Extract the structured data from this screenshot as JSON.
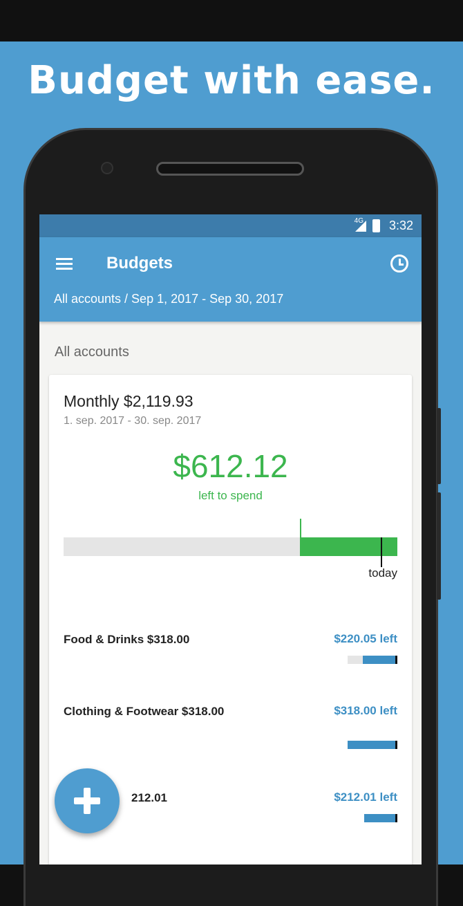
{
  "promo": {
    "headline": "Budget with ease."
  },
  "status_bar": {
    "network": "4G",
    "time": "3:32"
  },
  "app_bar": {
    "title": "Budgets",
    "subtitle": "All accounts / Sep 1, 2017 - Sep 30, 2017",
    "menu_icon": "hamburger-menu-icon",
    "history_icon": "clock-history-icon"
  },
  "section": {
    "label": "All accounts"
  },
  "budget": {
    "title": "Monthly $2,119.93",
    "dates": "1. sep. 2017 - 30. sep. 2017",
    "left_amount": "$612.12",
    "left_label": "left to spend",
    "spent_fraction": 0.711,
    "today_fraction": 0.953,
    "today_label": "today"
  },
  "categories": [
    {
      "name": "Food & Drinks $318.00",
      "left": "$220.05 left",
      "remaining_fraction": 0.69
    },
    {
      "name": "Clothing & Footwear $318.00",
      "left": "$318.00 left",
      "remaining_fraction": 1.0
    },
    {
      "name": "212.01",
      "left": "$212.01 left",
      "remaining_fraction": 1.0
    }
  ],
  "fab": {
    "icon": "plus-icon"
  },
  "colors": {
    "brand": "#4f9dd0",
    "status_bar": "#3d7cab",
    "positive": "#3cb64e",
    "category": "#3d8fc4"
  }
}
